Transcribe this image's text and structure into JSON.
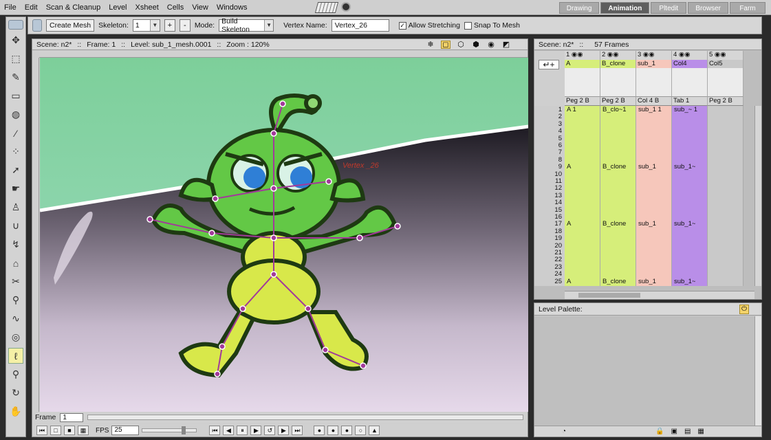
{
  "menu": [
    "File",
    "Edit",
    "Scan & Cleanup",
    "Level",
    "Xsheet",
    "Cells",
    "View",
    "Windows"
  ],
  "rooms": [
    {
      "label": "Drawing",
      "active": false
    },
    {
      "label": "Animation",
      "active": true
    },
    {
      "label": "Pltedit",
      "active": false
    },
    {
      "label": "Browser",
      "active": false
    },
    {
      "label": "Farm",
      "active": false
    }
  ],
  "tool_options": {
    "create_mesh": "Create Mesh",
    "skeleton_label": "Skeleton:",
    "skeleton_value": "1",
    "plus": "+",
    "minus": "-",
    "mode_label": "Mode:",
    "mode_value": "Build Skeleton",
    "vertex_name_label": "Vertex Name:",
    "vertex_name_value": "Vertex_26",
    "allow_stretching": "Allow Stretching",
    "snap_to_mesh": "Snap To Mesh"
  },
  "viewer": {
    "scene": "Scene: n2*",
    "frame": "Frame: 1",
    "level": "Level: sub_1_mesh.0001",
    "zoom": "Zoom : 120%",
    "canvas_vertex_label": "Vertex _26",
    "frame_label": "Frame",
    "frame_value": "1",
    "fps_label": "FPS",
    "fps_value": "25"
  },
  "xsheet": {
    "scene": "Scene: n2*",
    "frames": "57 Frames",
    "columns": [
      {
        "num": "1",
        "name": "A",
        "peg": "Peg 2",
        "pb": "B",
        "color": "#d6ee7a",
        "cells": [
          {
            "row": 1,
            "text": "A      1"
          },
          {
            "row": 9,
            "text": "A"
          },
          {
            "row": 17,
            "text": "A"
          },
          {
            "row": 25,
            "text": "A"
          }
        ]
      },
      {
        "num": "2",
        "name": "B_clone",
        "peg": "Peg 2",
        "pb": "B",
        "color": "#d6ee7a",
        "cells": [
          {
            "row": 1,
            "text": "B_clo~1"
          },
          {
            "row": 9,
            "text": "B_clone"
          },
          {
            "row": 17,
            "text": "B_clone"
          },
          {
            "row": 25,
            "text": "B_clone"
          }
        ]
      },
      {
        "num": "3",
        "name": "sub_1",
        "peg": "Col 4",
        "pb": "B",
        "color": "#f6c7bb",
        "cells": [
          {
            "row": 1,
            "text": "sub_1  1"
          },
          {
            "row": 9,
            "text": "sub_1"
          },
          {
            "row": 17,
            "text": "sub_1"
          },
          {
            "row": 25,
            "text": "sub_1"
          }
        ]
      },
      {
        "num": "4",
        "name": "Col4",
        "peg": "Tab 1",
        "pb": "",
        "color": "#b98ee8",
        "cells": [
          {
            "row": 1,
            "text": "sub_~ 1"
          },
          {
            "row": 9,
            "text": "sub_1~"
          },
          {
            "row": 17,
            "text": "sub_1~"
          },
          {
            "row": 25,
            "text": "sub_1~"
          }
        ]
      },
      {
        "num": "5",
        "name": "Col5",
        "peg": "Peg 2",
        "pb": "B",
        "color": "#c9c9c9",
        "cells": []
      }
    ],
    "frame_numbers": [
      "1",
      "2",
      "3",
      "4",
      "5",
      "6",
      "7",
      "8",
      "9",
      "10",
      "11",
      "12",
      "13",
      "14",
      "15",
      "16",
      "17",
      "18",
      "19",
      "20",
      "21",
      "22",
      "23",
      "24",
      "25"
    ]
  },
  "palette": {
    "title": "Level Palette:"
  },
  "colors": {
    "canvas_top": "#7dcf9a",
    "alien_green": "#63c846",
    "alien_yellow": "#d8e84a",
    "joint": "#a23a9a"
  }
}
